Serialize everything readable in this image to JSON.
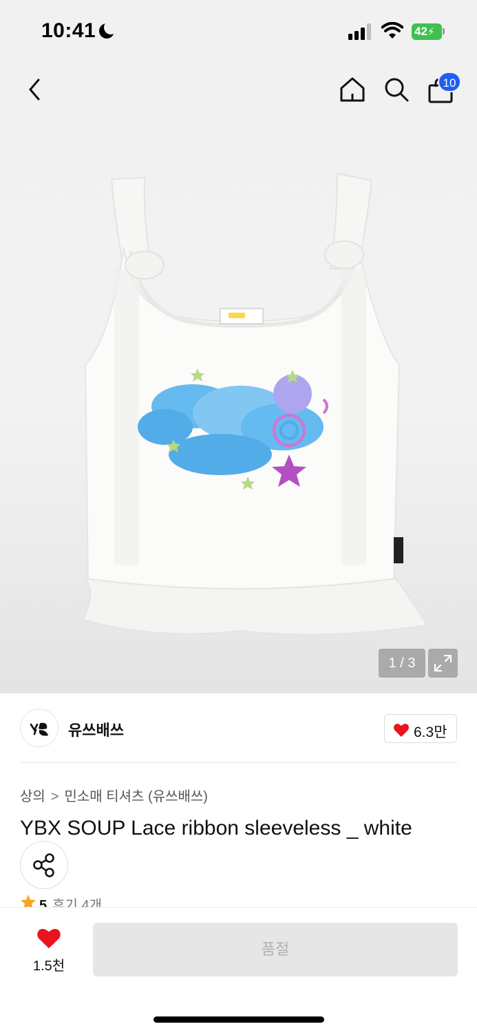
{
  "status_bar": {
    "time": "10:41",
    "battery": "42"
  },
  "nav": {
    "cart_count": "10",
    "icons": [
      "back-icon",
      "home-icon",
      "search-icon",
      "shopping-bag-icon"
    ]
  },
  "gallery": {
    "counter": "1 / 3",
    "current_image": 1,
    "total_images": 3
  },
  "brand": {
    "name": "유쓰배쓰",
    "likes": "6.3만"
  },
  "breadcrumb": [
    "상의",
    "민소매 티셔츠 (유쓰배쓰)"
  ],
  "product": {
    "title": "YBX SOUP Lace ribbon sleeveless _ white",
    "rating": "5",
    "reviews": "후기 4개"
  },
  "bottom_bar": {
    "wish_count": "1.5천",
    "action_label": "품절"
  },
  "colors": {
    "accent_blue": "#1f5ef5",
    "heart_red": "#e8141e",
    "star_orange": "#f5a623",
    "battery_green": "#3ec14e"
  }
}
